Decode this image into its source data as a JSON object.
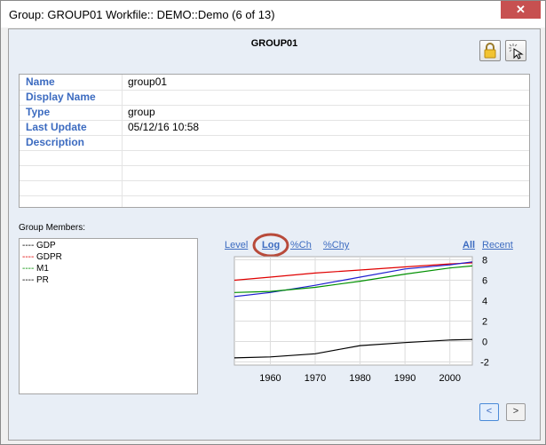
{
  "window": {
    "title": "Group: GROUP01 Workfile:: DEMO::Demo (6 of 13)",
    "close_glyph": "✕"
  },
  "panel": {
    "group_title": "GROUP01",
    "lock_icon": "lock-icon",
    "cursor_icon": "cursor-highlight-icon"
  },
  "properties": [
    {
      "label": "Name",
      "value": "group01"
    },
    {
      "label": "Display Name",
      "value": ""
    },
    {
      "label": "Type",
      "value": "group"
    },
    {
      "label": "Last Update",
      "value": "05/12/16  10:58"
    },
    {
      "label": "Description",
      "value": ""
    }
  ],
  "members": {
    "label": "Group Members:",
    "items": [
      {
        "name": "GDP",
        "dash": "----",
        "color": "#000000"
      },
      {
        "name": "GDPR",
        "dash": "----",
        "color": "#e00000"
      },
      {
        "name": "M1",
        "dash": "----",
        "color": "#009000"
      },
      {
        "name": "PR",
        "dash": "----",
        "color": "#000000"
      }
    ]
  },
  "chart_links": {
    "level": "Level",
    "log": "Log",
    "pch": "%Ch",
    "pchy": "%Chy",
    "all": "All",
    "recent": "Recent"
  },
  "chart_data": {
    "type": "line",
    "xlim": [
      1952,
      2005
    ],
    "ylim": [
      -2.3,
      8.3
    ],
    "xticks": [
      1960,
      1970,
      1980,
      1990,
      2000
    ],
    "yticks": [
      8,
      6,
      4,
      2,
      0,
      -2
    ],
    "grid": true,
    "series": [
      {
        "color": "#e00000",
        "x": [
          1952,
          1960,
          1970,
          1980,
          1990,
          2000,
          2005
        ],
        "y": [
          6.0,
          6.3,
          6.7,
          7.0,
          7.3,
          7.6,
          7.7
        ]
      },
      {
        "color": "#1f1fd0",
        "x": [
          1952,
          1960,
          1970,
          1980,
          1990,
          2000,
          2005
        ],
        "y": [
          4.4,
          4.8,
          5.5,
          6.3,
          7.1,
          7.5,
          7.8
        ]
      },
      {
        "color": "#009000",
        "x": [
          1952,
          1960,
          1970,
          1980,
          1990,
          2000,
          2005
        ],
        "y": [
          4.8,
          4.9,
          5.3,
          5.9,
          6.6,
          7.2,
          7.4
        ]
      },
      {
        "color": "#000000",
        "x": [
          1952,
          1960,
          1970,
          1975,
          1980,
          1990,
          2000,
          2005
        ],
        "y": [
          -1.6,
          -1.5,
          -1.2,
          -0.8,
          -0.4,
          -0.1,
          0.15,
          0.2
        ]
      }
    ]
  },
  "navigation": {
    "prev_label": "<",
    "next_label": ">"
  },
  "colors": {
    "link": "#3c6bc0",
    "highlight_circle": "#b84a3a"
  }
}
